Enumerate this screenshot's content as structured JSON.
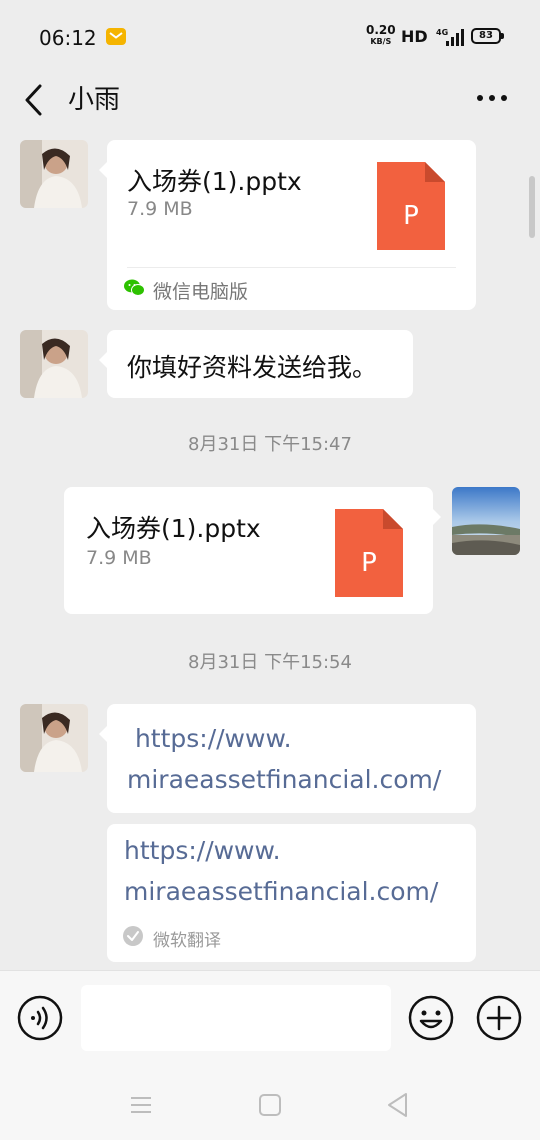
{
  "status_bar": {
    "time": "06:12",
    "net_speed_value": "0.20",
    "net_speed_unit": "KB/S",
    "hd": "HD",
    "network": "4G",
    "battery": "83"
  },
  "header": {
    "title": "小雨",
    "back_icon": "chevron-left-icon",
    "more_icon": "more-horizontal-icon"
  },
  "messages": [
    {
      "type": "file",
      "side": "left",
      "file_name": "入场券(1).pptx",
      "file_size": "7.9 MB",
      "file_icon_letter": "P",
      "source": "微信电脑版"
    },
    {
      "type": "text",
      "side": "left",
      "text": "你填好资料发送给我。"
    },
    {
      "type": "timestamp",
      "text": "8月31日 下午15:47"
    },
    {
      "type": "file",
      "side": "right",
      "file_name": "入场券(1).pptx",
      "file_size": "7.9 MB",
      "file_icon_letter": "P"
    },
    {
      "type": "timestamp",
      "text": "8月31日 下午15:54"
    },
    {
      "type": "link",
      "side": "left",
      "lines": [
        " https://www.",
        "miraeassetfinancial.com/"
      ]
    },
    {
      "type": "translation",
      "side": "left",
      "lines": [
        "https://www.",
        "miraeassetfinancial.com/"
      ],
      "label": "微软翻译"
    }
  ],
  "colors": {
    "background": "#ededed",
    "bubble": "#ffffff",
    "ppt_icon": "#f2613f",
    "link": "#576b95"
  }
}
